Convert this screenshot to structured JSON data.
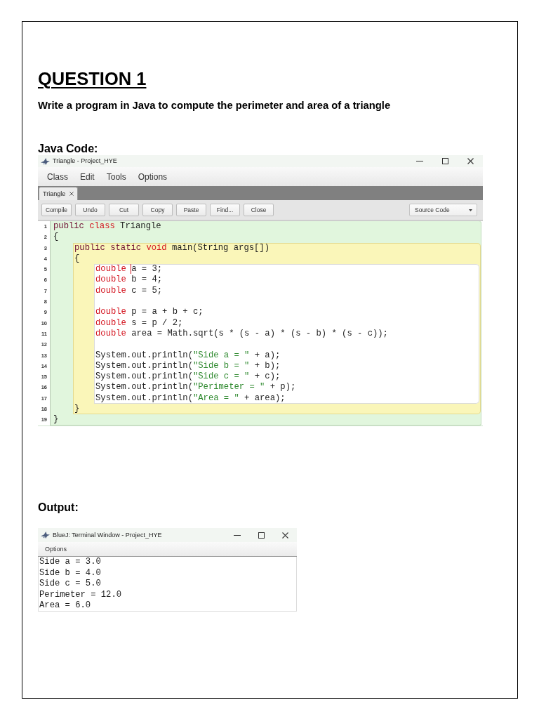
{
  "question": {
    "title": "QUESTION 1",
    "prompt": "Write a program in Java to compute the perimeter and area of a triangle"
  },
  "code_section": {
    "heading": "Java Code:",
    "editor": {
      "title": "Triangle - Project_HYE",
      "menus": [
        "Class",
        "Edit",
        "Tools",
        "Options"
      ],
      "tabs": [
        {
          "label": "Triangle",
          "selected": true
        }
      ],
      "toolbar": [
        "Compile",
        "Undo",
        "Cut",
        "Copy",
        "Paste",
        "Find...",
        "Close"
      ],
      "view_select": {
        "value": "Source Code"
      },
      "code": {
        "kind": "class",
        "lines": [
          {
            "number": "1",
            "tokens": [
              {
                "kind": "modifier",
                "text": "public "
              },
              {
                "kind": "keyword",
                "text": "class"
              },
              {
                "kind": "plain",
                "text": " Triangle"
              }
            ]
          },
          {
            "number": "2",
            "tokens": [
              {
                "kind": "plain",
                "text": "{"
              }
            ]
          }
        ],
        "children": [
          {
            "kind": "method",
            "lines": [
              {
                "number": "3",
                "tokens": [
                  {
                    "kind": "modifier",
                    "text": "public static "
                  },
                  {
                    "kind": "keyword",
                    "text": "void"
                  },
                  {
                    "kind": "plain",
                    "text": " main(String args[])"
                  }
                ]
              },
              {
                "number": "4",
                "tokens": [
                  {
                    "kind": "plain",
                    "text": "{"
                  }
                ]
              }
            ],
            "children": [
              {
                "kind": "body",
                "lines": [
                  {
                    "number": "5",
                    "tokens": [
                      {
                        "kind": "keyword",
                        "text": "double "
                      },
                      {
                        "kind": "caret"
                      },
                      {
                        "kind": "plain",
                        "text": "a = 3;"
                      }
                    ]
                  },
                  {
                    "number": "6",
                    "tokens": [
                      {
                        "kind": "keyword",
                        "text": "double"
                      },
                      {
                        "kind": "plain",
                        "text": " b = 4;"
                      }
                    ]
                  },
                  {
                    "number": "7",
                    "tokens": [
                      {
                        "kind": "keyword",
                        "text": "double"
                      },
                      {
                        "kind": "plain",
                        "text": " c = 5;"
                      }
                    ]
                  },
                  {
                    "number": "8"
                  },
                  {
                    "number": "9",
                    "tokens": [
                      {
                        "kind": "keyword",
                        "text": "double"
                      },
                      {
                        "kind": "plain",
                        "text": " p = a + b + c;"
                      }
                    ]
                  },
                  {
                    "number": "10",
                    "tokens": [
                      {
                        "kind": "keyword",
                        "text": "double"
                      },
                      {
                        "kind": "plain",
                        "text": " s = p / 2;"
                      }
                    ]
                  },
                  {
                    "number": "11",
                    "tokens": [
                      {
                        "kind": "keyword",
                        "text": "double"
                      },
                      {
                        "kind": "plain",
                        "text": " area = Math.sqrt(s * (s - a) * (s - b) * (s - c));"
                      }
                    ]
                  },
                  {
                    "number": "12"
                  },
                  {
                    "number": "13",
                    "tokens": [
                      {
                        "kind": "plain",
                        "text": "System.out.println("
                      },
                      {
                        "kind": "string",
                        "text": "\"Side a = \""
                      },
                      {
                        "kind": "plain",
                        "text": " + a);"
                      }
                    ]
                  },
                  {
                    "number": "14",
                    "tokens": [
                      {
                        "kind": "plain",
                        "text": "System.out.println("
                      },
                      {
                        "kind": "string",
                        "text": "\"Side b = \""
                      },
                      {
                        "kind": "plain",
                        "text": " + b);"
                      }
                    ]
                  },
                  {
                    "number": "15",
                    "tokens": [
                      {
                        "kind": "plain",
                        "text": "System.out.println("
                      },
                      {
                        "kind": "string",
                        "text": "\"Side c = \""
                      },
                      {
                        "kind": "plain",
                        "text": " + c);"
                      }
                    ]
                  },
                  {
                    "number": "16",
                    "tokens": [
                      {
                        "kind": "plain",
                        "text": "System.out.println("
                      },
                      {
                        "kind": "string",
                        "text": "\"Perimeter = \""
                      },
                      {
                        "kind": "plain",
                        "text": " + p);"
                      }
                    ]
                  },
                  {
                    "number": "17",
                    "tokens": [
                      {
                        "kind": "plain",
                        "text": "System.out.println("
                      },
                      {
                        "kind": "string",
                        "text": "\"Area = \""
                      },
                      {
                        "kind": "plain",
                        "text": " + area);"
                      }
                    ]
                  }
                ]
              }
            ],
            "end_lines": [
              {
                "number": "18",
                "tokens": [
                  {
                    "kind": "plain",
                    "text": "}"
                  }
                ]
              }
            ]
          }
        ],
        "end_lines": [
          {
            "number": "19",
            "tokens": [
              {
                "kind": "plain",
                "text": "}"
              }
            ]
          }
        ]
      }
    }
  },
  "output_section": {
    "heading": "Output:",
    "terminal": {
      "title": "BlueJ: Terminal Window - Project_HYE",
      "menus": [
        "Options"
      ],
      "lines": [
        "Side a = 3.0",
        "Side b = 4.0",
        "Side c = 5.0",
        "Perimeter = 12.0",
        "Area = 6.0"
      ]
    }
  }
}
